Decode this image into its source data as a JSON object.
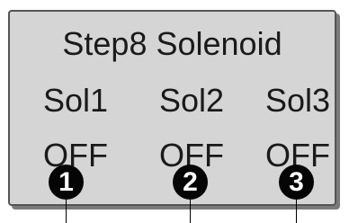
{
  "title": "Step8 Solenoid",
  "solenoids": [
    {
      "name": "Sol1",
      "state": "OFF",
      "marker": "1"
    },
    {
      "name": "Sol2",
      "state": "OFF",
      "marker": "2"
    },
    {
      "name": "Sol3",
      "state": "OFF",
      "marker": "3"
    }
  ],
  "colors": {
    "panel_bg": "#d5d5d5",
    "panel_border": "#555555",
    "text": "#1a1a1a",
    "marker_bg": "#050505",
    "marker_text": "#ffffff"
  }
}
